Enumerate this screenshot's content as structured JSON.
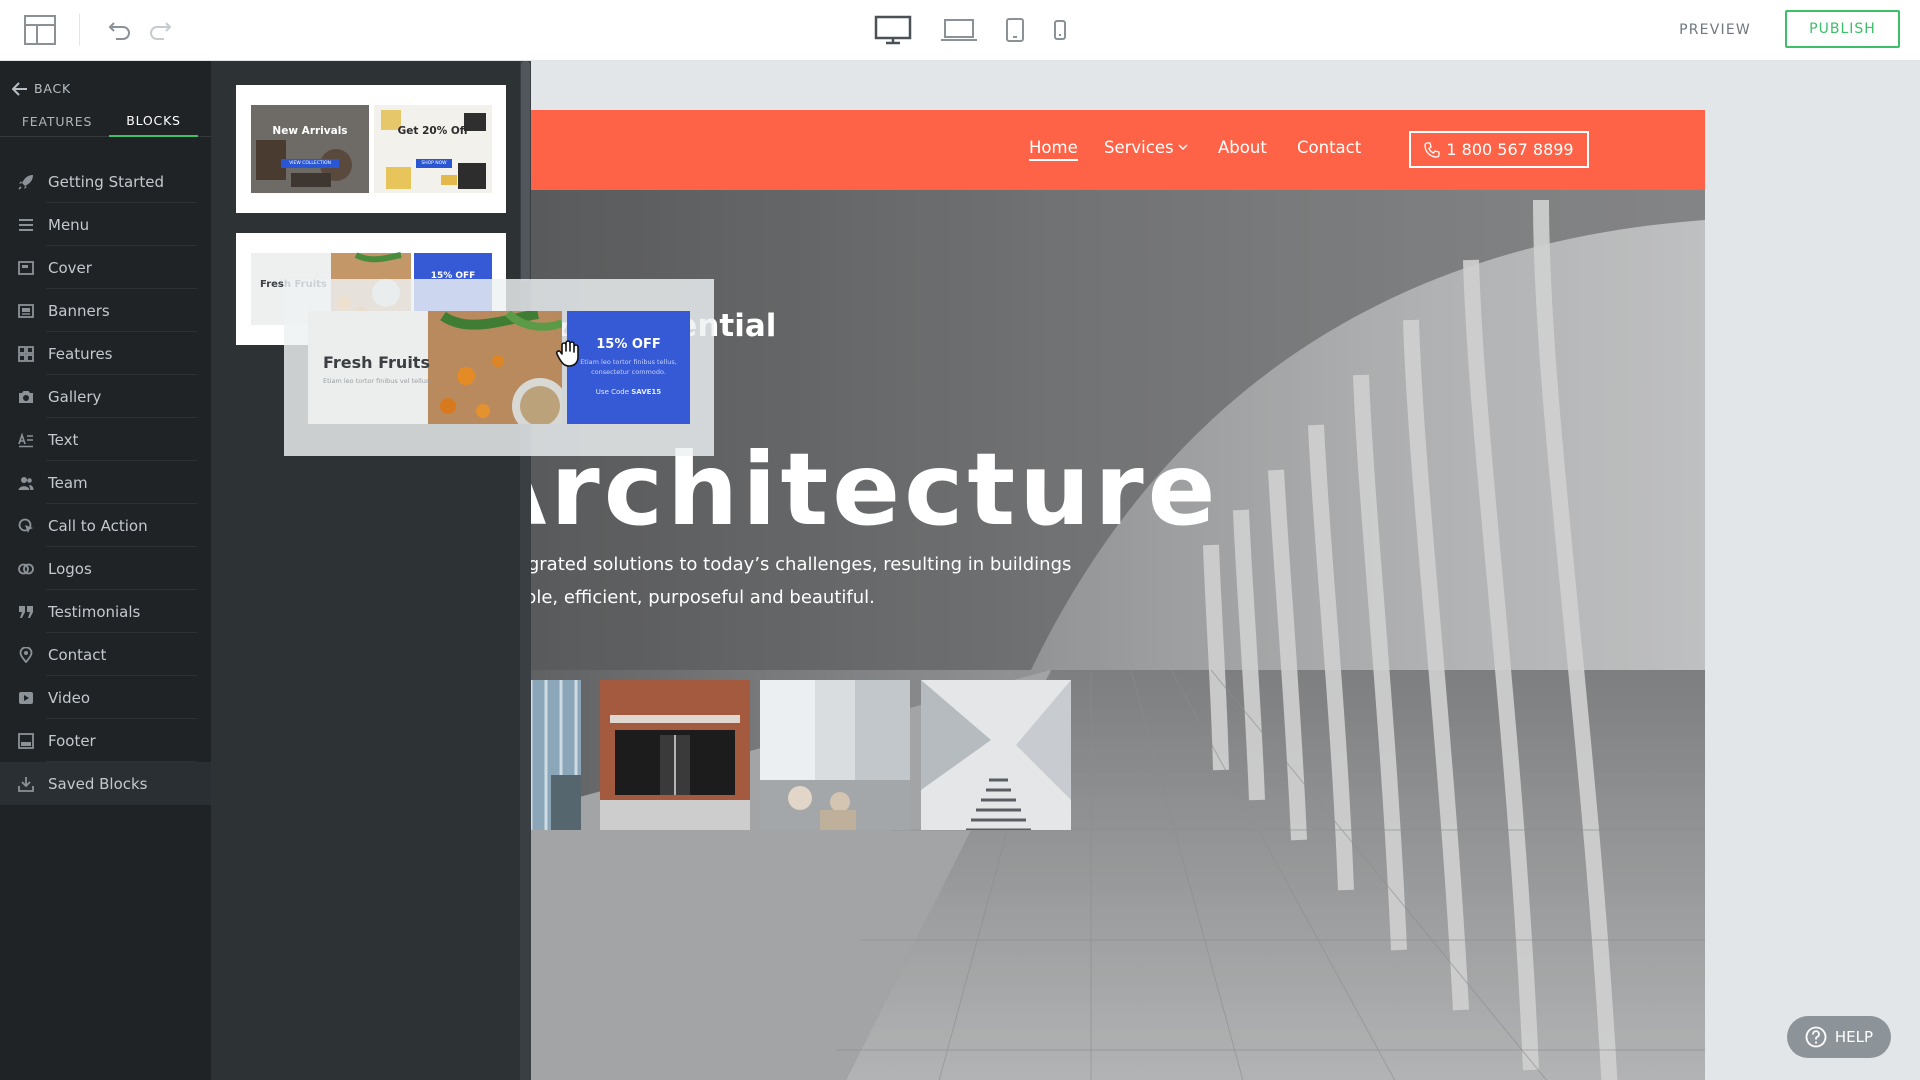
{
  "toolbar": {
    "layout_icon": "layout-icon",
    "undo_icon": "undo-icon",
    "redo_icon": "redo-icon",
    "devices": [
      "desktop-icon",
      "laptop-icon",
      "tablet-icon",
      "mobile-icon"
    ],
    "preview_label": "PREVIEW",
    "publish_label": "PUBLISH",
    "accent": "#3dbf6a"
  },
  "sidebar": {
    "back_label": "BACK",
    "tabs": [
      {
        "label": "FEATURES",
        "active": false
      },
      {
        "label": "BLOCKS",
        "active": true
      }
    ],
    "items": [
      {
        "label": "Getting Started",
        "icon": "rocket-icon"
      },
      {
        "label": "Menu",
        "icon": "menu-icon"
      },
      {
        "label": "Cover",
        "icon": "cover-icon"
      },
      {
        "label": "Banners",
        "icon": "banner-icon"
      },
      {
        "label": "Features",
        "icon": "grid-icon"
      },
      {
        "label": "Gallery",
        "icon": "camera-icon"
      },
      {
        "label": "Text",
        "icon": "text-icon"
      },
      {
        "label": "Team",
        "icon": "team-icon"
      },
      {
        "label": "Call to Action",
        "icon": "cursor-icon"
      },
      {
        "label": "Logos",
        "icon": "logos-icon"
      },
      {
        "label": "Testimonials",
        "icon": "quote-icon"
      },
      {
        "label": "Contact",
        "icon": "location-pin-icon"
      },
      {
        "label": "Video",
        "icon": "video-icon"
      },
      {
        "label": "Footer",
        "icon": "footer-icon"
      },
      {
        "label": "Saved Blocks",
        "icon": "download-icon"
      }
    ]
  },
  "blocks": [
    {
      "left": {
        "title": "New Arrivals",
        "button": "VIEW COLLECTION"
      },
      "right": {
        "title": "Get 20% Off",
        "button": "SHOP NOW"
      }
    },
    {
      "left": {
        "title": "Fresh Fruits"
      },
      "right": {
        "title": "15% OFF"
      }
    }
  ],
  "drag_preview": {
    "title": "Fresh Fruits",
    "subtitle": "Etiam leo tortor finibus vel tellus.",
    "offer_title": "15% OFF",
    "offer_text_1": "Etiam leo tortor finibus tellus,",
    "offer_text_2": "consectetur commodo.",
    "code_prefix": "Use Code ",
    "code": "SAVE15",
    "offer_color": "#3659d6"
  },
  "site": {
    "brand_color": "#ff6347",
    "nav": [
      {
        "label": "Home",
        "active": true
      },
      {
        "label": "Services",
        "dropdown": true
      },
      {
        "label": "About"
      },
      {
        "label": "Contact"
      }
    ],
    "phone": "1 800 567 8899",
    "hero_kicker": "Commercial & Residential",
    "hero_title": "Architecture",
    "hero_text": "Integrated solutions to today’s challenges, resulting in buildings simple, efficient, purposeful and beautiful."
  },
  "help_label": "HELP"
}
